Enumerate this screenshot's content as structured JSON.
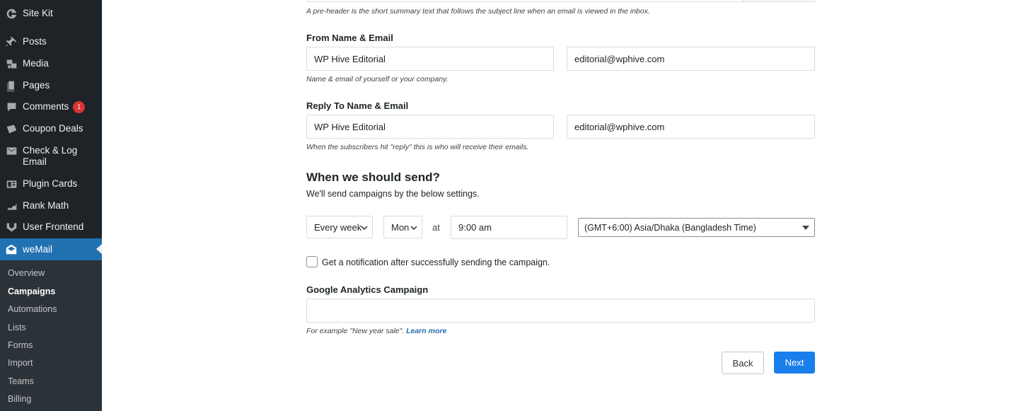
{
  "sidebar": {
    "items": [
      {
        "label": "Site Kit",
        "icon": "google-g-icon"
      },
      {
        "label": "Posts",
        "icon": "pin-icon"
      },
      {
        "label": "Media",
        "icon": "media-icon"
      },
      {
        "label": "Pages",
        "icon": "pages-icon"
      },
      {
        "label": "Comments",
        "icon": "comment-icon",
        "badge": "1"
      },
      {
        "label": "Coupon Deals",
        "icon": "coupon-icon"
      },
      {
        "label": "Check & Log Email",
        "icon": "email-icon"
      },
      {
        "label": "Plugin Cards",
        "icon": "cards-icon"
      },
      {
        "label": "Rank Math",
        "icon": "rank-math-icon"
      },
      {
        "label": "User Frontend",
        "icon": "user-frontend-icon"
      }
    ],
    "active": {
      "label": "weMail",
      "icon": "wemail-icon"
    },
    "submenu": [
      "Overview",
      "Campaigns",
      "Automations",
      "Lists",
      "Forms",
      "Import",
      "Teams",
      "Billing"
    ],
    "submenu_current": "Campaigns"
  },
  "form": {
    "preheader_help": "A pre-header is the short summary text that follows the subject line when an email is viewed in the inbox.",
    "from": {
      "label": "From Name & Email",
      "name": "WP Hive Editorial",
      "email": "editorial@wphive.com",
      "help": "Name & email of yourself or your company."
    },
    "reply": {
      "label": "Reply To Name & Email",
      "name": "WP Hive Editorial",
      "email": "editorial@wphive.com",
      "help": "When the subscribers hit \"reply\" this is who will receive their emails."
    },
    "schedule": {
      "title": "When we should send?",
      "desc": "We'll send campaigns by the below settings.",
      "frequency": "Every week",
      "day": "Mon",
      "at": "at",
      "time": "9:00 am",
      "timezone": "(GMT+6:00) Asia/Dhaka (Bangladesh Time)"
    },
    "notify_label": "Get a notification after successfully sending the campaign.",
    "notify_checked": false,
    "analytics": {
      "label": "Google Analytics Campaign",
      "value": "",
      "help_prefix": "For example \"New year sale\". ",
      "help_link": "Learn more"
    },
    "buttons": {
      "back": "Back",
      "next": "Next"
    }
  },
  "colors": {
    "sidebar_bg": "#1d2327",
    "accent": "#2271b1",
    "next_button": "#1a7eea",
    "badge": "#d63638"
  }
}
